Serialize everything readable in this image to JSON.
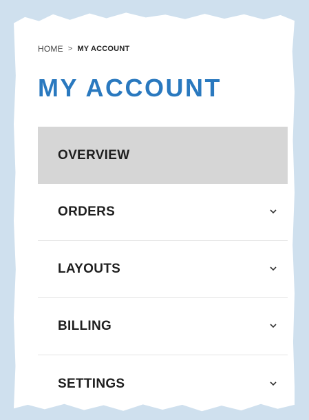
{
  "breadcrumb": {
    "home": "HOME",
    "separator": ">",
    "current": "MY ACCOUNT"
  },
  "page_title": "MY ACCOUNT",
  "menu": {
    "items": [
      {
        "label": "OVERVIEW",
        "active": true,
        "has_chevron": false
      },
      {
        "label": "ORDERS",
        "active": false,
        "has_chevron": true,
        "icon": "chevron-down-icon"
      },
      {
        "label": "LAYOUTS",
        "active": false,
        "has_chevron": true,
        "icon": "chevron-down-icon"
      },
      {
        "label": "BILLING",
        "active": false,
        "has_chevron": true,
        "icon": "chevron-down-icon"
      },
      {
        "label": "SETTINGS",
        "active": false,
        "has_chevron": true,
        "icon": "chevron-down-icon"
      }
    ]
  },
  "colors": {
    "background": "#cfe0ee",
    "title": "#2a79bf",
    "active_item": "#d6d6d6"
  }
}
